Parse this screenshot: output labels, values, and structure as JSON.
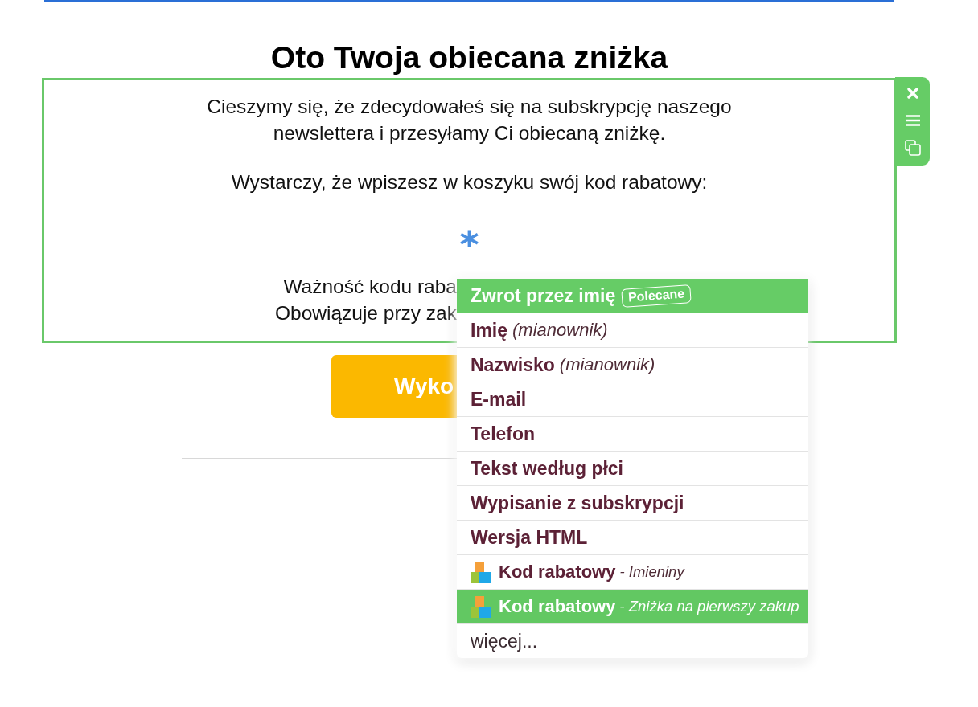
{
  "heading": "Oto Twoja obiecana zniżka",
  "editor_block": {
    "toolbar": [
      {
        "kind": "close"
      },
      {
        "kind": "menu"
      },
      {
        "kind": "duplicate"
      }
    ],
    "content": [
      {
        "kind": "text",
        "text": "Cieszymy się, że zdecydowałeś się na subskrypcję naszego\nnewslettera i przesyłamy Ci obiecaną zniżkę."
      },
      {
        "kind": "text",
        "text": "Wystarczy, że wpiszesz w koszyku swój kod rabatowy:"
      },
      {
        "kind": "code_marker",
        "text": "*"
      },
      {
        "kind": "covered_text",
        "text": "Ważność kodu raba\nObowiązuje przy zak"
      }
    ]
  },
  "cta_button": {
    "label": "Wyko"
  },
  "dropdown": {
    "header": {
      "label": "Zwrot przez imię",
      "badge": "Polecane"
    },
    "items": [
      {
        "kind": "field",
        "label": "Imię",
        "note": "(mianownik)",
        "selected": false
      },
      {
        "kind": "field",
        "label": "Nazwisko",
        "note": "(mianownik)",
        "selected": false
      },
      {
        "kind": "field",
        "label": "E-mail",
        "selected": false
      },
      {
        "kind": "field",
        "label": "Telefon",
        "selected": false
      },
      {
        "kind": "field",
        "label": "Tekst według płci",
        "selected": false
      },
      {
        "kind": "field",
        "label": "Wypisanie z subskrypcji",
        "selected": false
      },
      {
        "kind": "field",
        "label": "Wersja HTML",
        "selected": false
      },
      {
        "kind": "coupon",
        "label": "Kod rabatowy",
        "note": "- Imieniny",
        "selected": false
      },
      {
        "kind": "coupon",
        "label": "Kod rabatowy",
        "note": "- Zniżka na pierwszy zakup",
        "selected": true
      },
      {
        "kind": "more",
        "label": "więcej...",
        "selected": false
      }
    ]
  }
}
